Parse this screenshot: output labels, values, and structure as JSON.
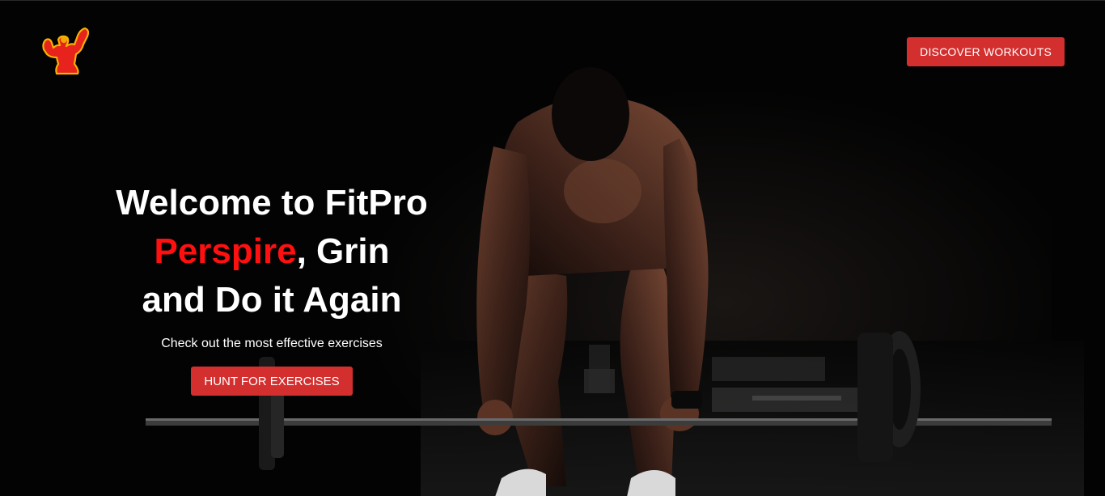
{
  "brand": {
    "logo_icon": "flexing-bodybuilder-icon",
    "accent_color": "#d32f2f",
    "highlight_color": "#ff1010"
  },
  "nav": {
    "cta_label": "DISCOVER WORKOUTS"
  },
  "hero": {
    "headline_line1": "Welcome to FitPro",
    "headline_accent": "Perspire",
    "headline_line2_rest": ", Grin",
    "headline_line3": "and Do it Again",
    "subtitle": "Check out the most effective exercises",
    "cta_label": "HUNT FOR EXERCISES",
    "background_image": "man-deadlift-barbell-dark-gym-photo"
  }
}
